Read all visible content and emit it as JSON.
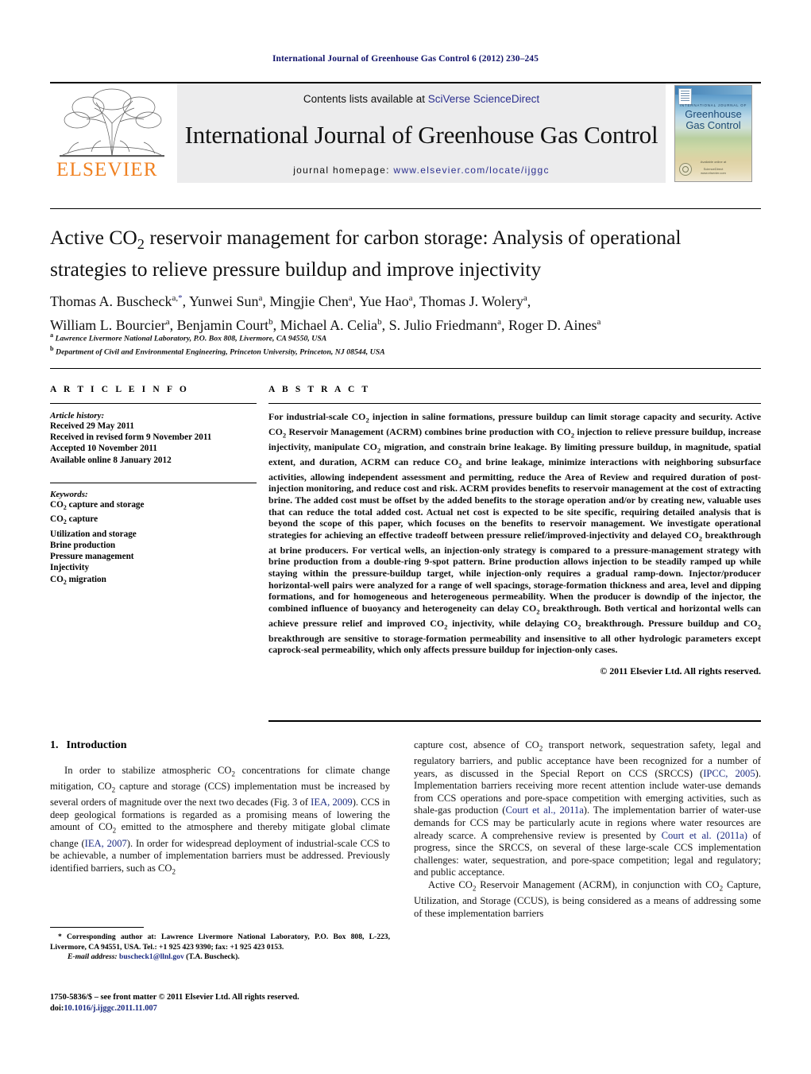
{
  "running_head": "International Journal of Greenhouse Gas Control 6 (2012) 230–245",
  "masthead": {
    "publisher_logo_text": "ELSEVIER",
    "contents_prefix": "Contents lists available at ",
    "contents_link": "SciVerse ScienceDirect",
    "journal_title": "International Journal of Greenhouse Gas Control",
    "homepage_label": "journal homepage:",
    "homepage_url": "www.elsevier.com/locate/ijggc",
    "cover": {
      "kicker": "INTERNATIONAL JOURNAL OF",
      "name_line1": "Greenhouse",
      "name_line2": "Gas Control",
      "caption": "Available online at",
      "imprint_line1": "ScienceDirect",
      "imprint_line2": "www.elsevier.com"
    }
  },
  "article": {
    "title": "Active CO2 reservoir management for carbon storage: Analysis of operational strategies to relieve pressure buildup and improve injectivity",
    "authors": [
      {
        "name": "Thomas A. Buscheck",
        "marks": "a,*"
      },
      {
        "name": "Yunwei Sun",
        "marks": "a"
      },
      {
        "name": "Mingjie Chen",
        "marks": "a"
      },
      {
        "name": "Yue Hao",
        "marks": "a"
      },
      {
        "name": "Thomas J. Wolery",
        "marks": "a"
      },
      {
        "name": "William L. Bourcier",
        "marks": "a"
      },
      {
        "name": "Benjamin Court",
        "marks": "b"
      },
      {
        "name": "Michael A. Celia",
        "marks": "b"
      },
      {
        "name": "S. Julio Friedmann",
        "marks": "a"
      },
      {
        "name": "Roger D. Aines",
        "marks": "a"
      }
    ],
    "affiliations": [
      {
        "mark": "a",
        "text": "Lawrence Livermore National Laboratory, P.O. Box 808, Livermore, CA 94550, USA"
      },
      {
        "mark": "b",
        "text": "Department of Civil and Environmental Engineering, Princeton University, Princeton, NJ 08544, USA"
      }
    ]
  },
  "article_info": {
    "heading": "A R T I C L E   I N F O",
    "history_label": "Article history:",
    "history": [
      "Received 29 May 2011",
      "Received in revised form 9 November 2011",
      "Accepted 10 November 2011",
      "Available online 8 January 2012"
    ],
    "keywords_label": "Keywords:",
    "keywords": [
      "CO2 capture and storage",
      "CO2 capture",
      "Utilization and storage",
      "Brine production",
      "Pressure management",
      "Injectivity",
      "CO2 migration"
    ]
  },
  "abstract": {
    "heading": "A B S T R A C T",
    "text": "For industrial-scale CO2 injection in saline formations, pressure buildup can limit storage capacity and security. Active CO2 Reservoir Management (ACRM) combines brine production with CO2 injection to relieve pressure buildup, increase injectivity, manipulate CO2 migration, and constrain brine leakage. By limiting pressure buildup, in magnitude, spatial extent, and duration, ACRM can reduce CO2 and brine leakage, minimize interactions with neighboring subsurface activities, allowing independent assessment and permitting, reduce the Area of Review and required duration of post-injection monitoring, and reduce cost and risk. ACRM provides benefits to reservoir management at the cost of extracting brine. The added cost must be offset by the added benefits to the storage operation and/or by creating new, valuable uses that can reduce the total added cost. Actual net cost is expected to be site specific, requiring detailed analysis that is beyond the scope of this paper, which focuses on the benefits to reservoir management. We investigate operational strategies for achieving an effective tradeoff between pressure relief/improved-injectivity and delayed CO2 breakthrough at brine producers. For vertical wells, an injection-only strategy is compared to a pressure-management strategy with brine production from a double-ring 9-spot pattern. Brine production allows injection to be steadily ramped up while staying within the pressure-buildup target, while injection-only requires a gradual ramp-down. Injector/producer horizontal-well pairs were analyzed for a range of well spacings, storage-formation thickness and area, level and dipping formations, and for homogeneous and heterogeneous permeability. When the producer is downdip of the injector, the combined influence of buoyancy and heterogeneity can delay CO2 breakthrough. Both vertical and horizontal wells can achieve pressure relief and improved CO2 injectivity, while delaying CO2 breakthrough. Pressure buildup and CO2 breakthrough are sensitive to storage-formation permeability and insensitive to all other hydrologic parameters except caprock-seal permeability, which only affects pressure buildup for injection-only cases.",
    "copyright": "© 2011 Elsevier Ltd. All rights reserved."
  },
  "introduction": {
    "number": "1.",
    "heading": "Introduction",
    "left_paragraphs": [
      "In order to stabilize atmospheric CO2 concentrations for climate change mitigation, CO2 capture and storage (CCS) implementation must be increased by several orders of magnitude over the next two decades (Fig. 3 of IEA, 2009). CCS in deep geological formations is regarded as a promising means of lowering the amount of CO2 emitted to the atmosphere and thereby mitigate global climate change (IEA, 2007). In order for widespread deployment of industrial-scale CCS to be achievable, a number of implementation barriers must be addressed. Previously identified barriers, such as CO2"
    ],
    "right_paragraphs": [
      "capture cost, absence of CO2 transport network, sequestration safety, legal and regulatory barriers, and public acceptance have been recognized for a number of years, as discussed in the Special Report on CCS (SRCCS) (IPCC, 2005). Implementation barriers receiving more recent attention include water-use demands from CCS operations and pore-space competition with emerging activities, such as shale-gas production (Court et al., 2011a). The implementation barrier of water-use demands for CCS may be particularly acute in regions where water resources are already scarce. A comprehensive review is presented by Court et al. (2011a) of progress, since the SRCCS, on several of these large-scale CCS implementation challenges: water, sequestration, and pore-space competition; legal and regulatory; and public acceptance.",
      "Active CO2 Reservoir Management (ACRM), in conjunction with CO2 Capture, Utilization, and Storage (CCUS), is being considered as a means of addressing some of these implementation barriers"
    ],
    "inline_refs": [
      "IEA, 2009",
      "IEA, 2007",
      "IPCC, 2005",
      "Court et al., 2011a",
      "Court et al. (2011a)"
    ]
  },
  "footnotes": {
    "corresponding": "* Corresponding author at: Lawrence Livermore National Laboratory, P.O. Box 808, L-223, Livermore, CA 94551, USA. Tel.: +1 925 423 9390; fax: +1 925 423 0153.",
    "email_label": "E-mail address:",
    "email": "buscheck1@llnl.gov",
    "email_owner": "(T.A. Buscheck).",
    "front_matter": "1750-5836/$ – see front matter © 2011 Elsevier Ltd. All rights reserved.",
    "doi_label": "doi:",
    "doi": "10.1016/j.ijggc.2011.11.007"
  },
  "colors": {
    "running_head": "#12146b",
    "link": "#2b2f8f",
    "reference": "#1b2a80",
    "elsevier_orange": "#f08121",
    "masthead_bg": "#ececed"
  }
}
